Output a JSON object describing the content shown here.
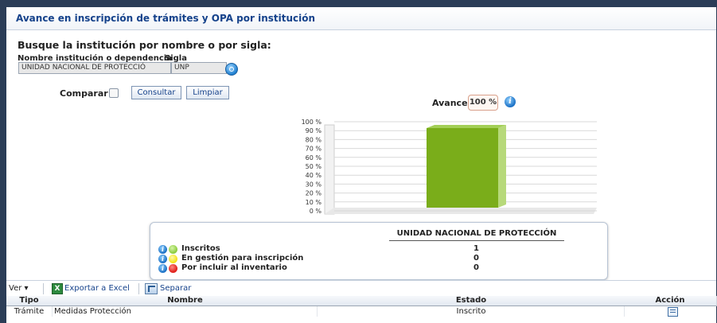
{
  "panel": {
    "title": "Avance en inscripción de trámites y OPA por institución"
  },
  "search": {
    "heading": "Busque la institución por nombre o por sigla:",
    "name_label": "Nombre institución o dependencia",
    "sigla_label": "Sigla",
    "name_value": "UNIDAD NACIONAL DE PROTECCIÓ",
    "sigla_value": "UNP",
    "compare_label": "Comparar",
    "consultar_label": "Consultar",
    "limpiar_label": "Limpiar"
  },
  "avance": {
    "label": "Avance de :",
    "value": "100 %"
  },
  "chart_data": {
    "type": "bar",
    "categories": [
      "UNIDAD NACIONAL DE PROTECCIÓN"
    ],
    "values": [
      100
    ],
    "y_ticks": [
      "100 %",
      "90 %",
      "80 %",
      "70 %",
      "60 %",
      "50 %",
      "40 %",
      "30 %",
      "20 %",
      "10 %",
      "0 %"
    ],
    "ylim": [
      0,
      100
    ],
    "bar_color": "#7aad1a",
    "grid": true
  },
  "legend": {
    "column_header": "UNIDAD NACIONAL DE PROTECCIÓN",
    "rows": [
      {
        "label": "Inscritos",
        "value": "1",
        "color": "#8ccc3f",
        "icon": "info-icon"
      },
      {
        "label": "En gestión para inscripción",
        "value": "0",
        "color": "#f2e21a",
        "icon": "info-icon"
      },
      {
        "label": "Por incluir al inventario",
        "value": "0",
        "color": "#e0201b",
        "icon": "info-icon"
      }
    ]
  },
  "toolbar": {
    "ver_label": "Ver ▾",
    "export_label": "Exportar a Excel",
    "separar_label": "Separar"
  },
  "table": {
    "headers": [
      "Tipo",
      "Nombre",
      "Estado",
      "Acción"
    ],
    "rows": [
      {
        "tipo": "Trámite",
        "nombre": "Medidas Protección",
        "estado": "Inscrito",
        "accion_icon": "table-icon"
      }
    ]
  }
}
